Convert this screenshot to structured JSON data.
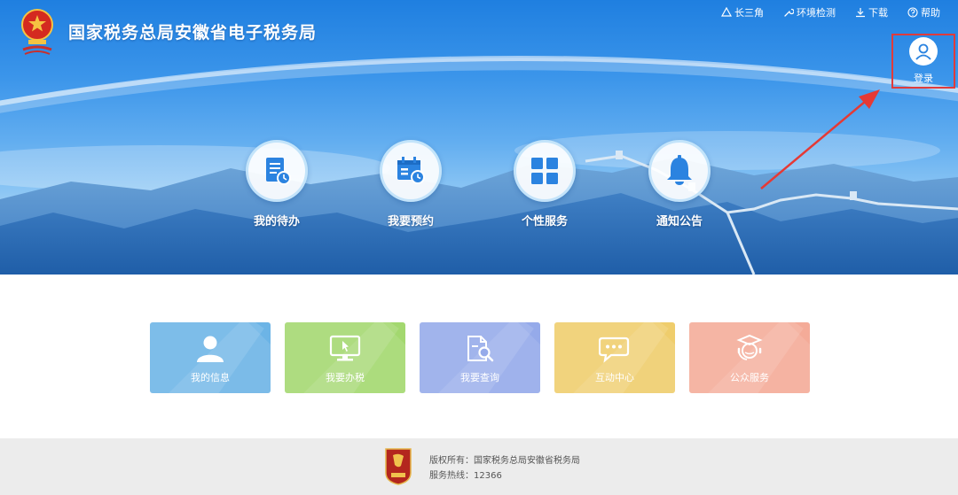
{
  "header": {
    "title": "国家税务总局安徽省电子税务局",
    "emblem_icon": "national-tax-emblem-icon",
    "links": [
      {
        "label": "长三角",
        "icon": "triangle-icon"
      },
      {
        "label": "环境检测",
        "icon": "wrench-icon"
      },
      {
        "label": "下载",
        "icon": "download-icon"
      },
      {
        "label": "帮助",
        "icon": "help-circle-icon"
      }
    ],
    "login": {
      "label": "登录",
      "icon": "user-icon"
    }
  },
  "quick_entries": [
    {
      "label": "我的待办",
      "icon": "todo-list-icon"
    },
    {
      "label": "我要预约",
      "icon": "calendar-clock-icon"
    },
    {
      "label": "个性服务",
      "icon": "grid-icon"
    },
    {
      "label": "通知公告",
      "icon": "bell-icon"
    }
  ],
  "tiles": [
    {
      "label": "我的信息",
      "icon": "user-icon",
      "color": "#6cb4e6"
    },
    {
      "label": "我要办税",
      "icon": "monitor-cursor-icon",
      "color": "#a3d86f"
    },
    {
      "label": "我要查询",
      "icon": "document-search-icon",
      "color": "#95aaea"
    },
    {
      "label": "互动中心",
      "icon": "chat-bubble-icon",
      "color": "#efcd6c"
    },
    {
      "label": "公众服务",
      "icon": "customer-service-icon",
      "color": "#f4ab98"
    }
  ],
  "footer": {
    "copyright": "版权所有：国家税务总局安徽省税务局",
    "hotline": "服务热线：12366",
    "badge_icon": "party-badge-icon"
  },
  "colors": {
    "banner_blue": "#2f86e3",
    "accent_blue": "#2b83e0",
    "highlight_red": "#e03b3b",
    "footer_bg": "#ececec"
  }
}
